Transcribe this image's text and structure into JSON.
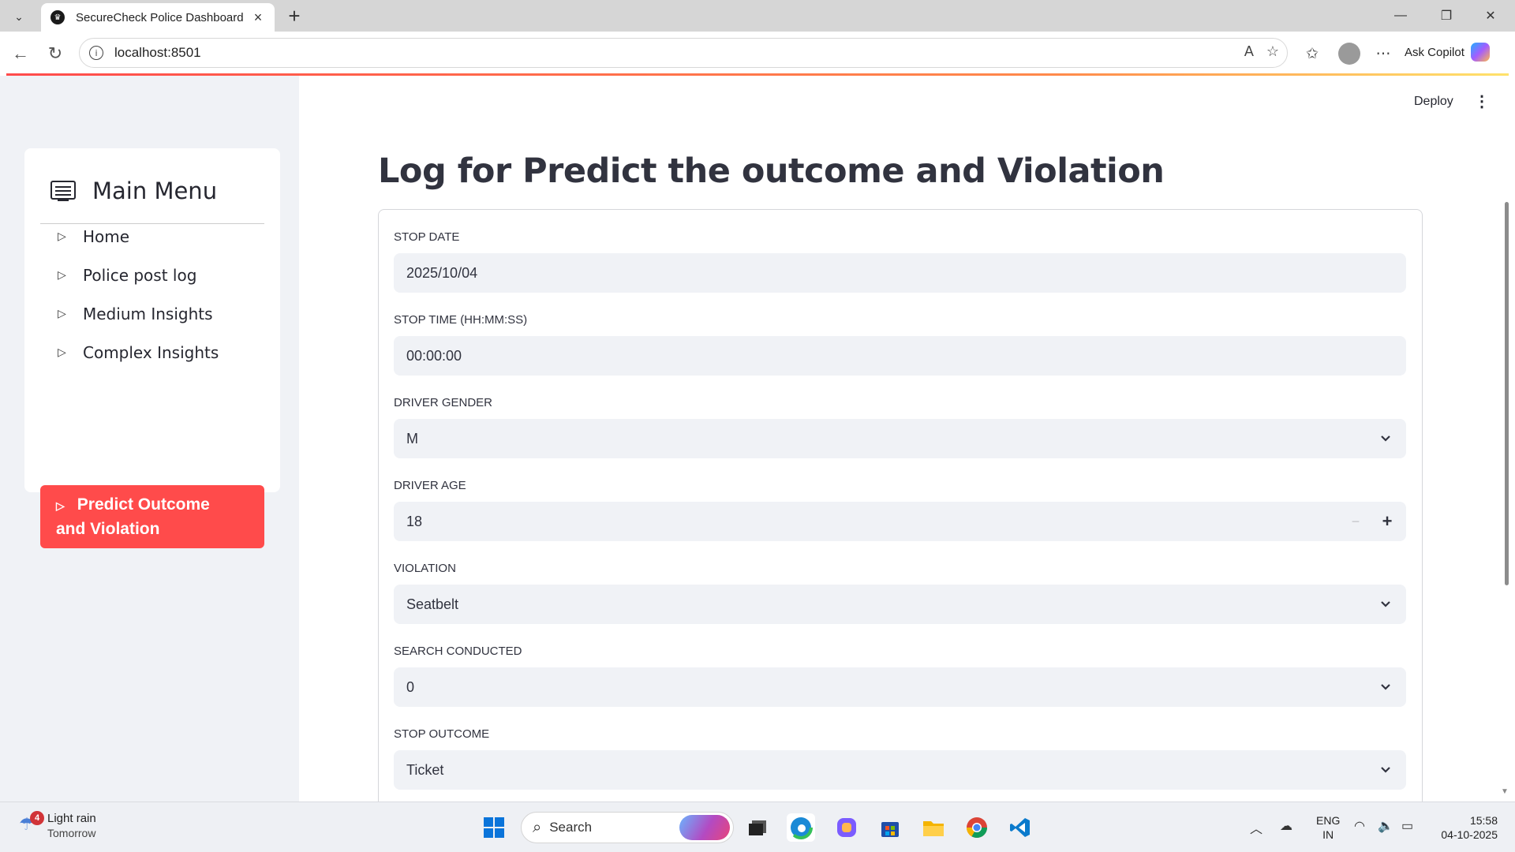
{
  "browser": {
    "tab_title": "SecureCheck Police Dashboard",
    "url": "localhost:8501",
    "ask_copilot": "Ask Copilot"
  },
  "toolbar": {
    "deploy_label": "Deploy"
  },
  "sidebar": {
    "menu_title": "Main Menu",
    "items": [
      {
        "label": "Home"
      },
      {
        "label": "Police post log"
      },
      {
        "label": "Medium Insights"
      },
      {
        "label": "Complex Insights"
      },
      {
        "label": "Predict Outcome and Violation",
        "line1": "Predict Outcome",
        "line2": "and Violation",
        "active": true
      }
    ]
  },
  "main": {
    "title": "Log for Predict the outcome and Violation",
    "fields": [
      {
        "label": "STOP DATE",
        "value": "2025/10/04",
        "type": "date"
      },
      {
        "label": "STOP TIME (HH:MM:SS)",
        "value": "00:00:00",
        "type": "text"
      },
      {
        "label": "DRIVER GENDER",
        "value": "M",
        "type": "select"
      },
      {
        "label": "DRIVER AGE",
        "value": "18",
        "type": "number"
      },
      {
        "label": "VIOLATION",
        "value": "Seatbelt",
        "type": "select"
      },
      {
        "label": "SEARCH CONDUCTED",
        "value": "0",
        "type": "select"
      },
      {
        "label": "STOP OUTCOME",
        "value": "Ticket",
        "type": "select"
      }
    ]
  },
  "taskbar": {
    "weather_title": "Light rain",
    "weather_subtitle": "Tomorrow",
    "weather_badge": "4",
    "search_label": "Search",
    "lang_line1": "ENG",
    "lang_line2": "IN",
    "time": "15:58",
    "date": "04-10-2025"
  },
  "colors": {
    "accent": "#ff4b4b",
    "sidebar_bg": "#f0f2f6",
    "input_bg": "#f0f2f6",
    "text": "#31333f"
  }
}
